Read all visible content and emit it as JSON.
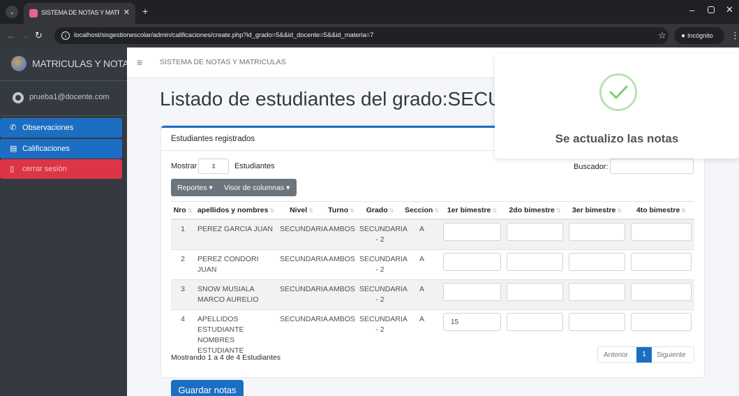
{
  "browser": {
    "tab_title": "SISTEMA DE NOTAS Y MATRICULAS",
    "url": "localhost/sisgestionescolar/admin/calificaciones/create.php?id_grado=5&&id_docente=5&&id_materia=7",
    "incognito_label": "Incógnito"
  },
  "sidebar": {
    "brand": "MATRICULAS Y NOTAS",
    "user": "prueba1@docente.com",
    "items": [
      {
        "label": "Observaciones",
        "icon": "megaphone-icon"
      },
      {
        "label": "Calificaciones",
        "icon": "list-icon"
      },
      {
        "label": "cerrar sesión",
        "icon": "door-icon"
      }
    ]
  },
  "navbar": {
    "title": "SISTEMA DE NOTAS Y MATRICULAS"
  },
  "page": {
    "heading": "Listado de estudiantes del grado:SECUNDA"
  },
  "card": {
    "title": "Estudiantes registrados",
    "show_label": "Mostrar",
    "show_suffix": "Estudiantes",
    "search_label": "Buscador:",
    "buttons": {
      "reports": "Reportes ▾",
      "columns": "Visor de columnas ▾"
    },
    "columns": [
      "Nro",
      "apellidos y nombres",
      "Nivel",
      "Turno",
      "Grado",
      "Seccion",
      "1er bimestre",
      "2do bimestre",
      "3er bimestre",
      "4to bimestre"
    ],
    "rows": [
      {
        "nro": "1",
        "name": "PEREZ GARCIA JUAN",
        "nivel": "SECUNDARIA",
        "turno": "AMBOS",
        "grado": "SECUNDARIA - 2",
        "seccion": "A",
        "b1": "",
        "b2": "",
        "b3": "",
        "b4": ""
      },
      {
        "nro": "2",
        "name": "PEREZ CONDORI JUAN",
        "nivel": "SECUNDARIA",
        "turno": "AMBOS",
        "grado": "SECUNDARIA - 2",
        "seccion": "A",
        "b1": "",
        "b2": "",
        "b3": "",
        "b4": ""
      },
      {
        "nro": "3",
        "name": "SNOW MUSIALA MARCO AURELIO",
        "nivel": "SECUNDARIA",
        "turno": "AMBOS",
        "grado": "SECUNDARIA - 2",
        "seccion": "A",
        "b1": "",
        "b2": "",
        "b3": "",
        "b4": ""
      },
      {
        "nro": "4",
        "name": "APELLIDOS ESTUDIANTE NOMBRES ESTUDIANTE",
        "nivel": "SECUNDARIA",
        "turno": "AMBOS",
        "grado": "SECUNDARIA - 2",
        "seccion": "A",
        "b1": "15",
        "b2": "",
        "b3": "",
        "b4": ""
      }
    ],
    "info": "Mostrando 1 a 4 de 4 Estudiantes",
    "pager": {
      "prev": "Anterior",
      "page": "1",
      "next": "Siguiente"
    }
  },
  "save_button": "Guardar notas",
  "toast": {
    "message": "Se actualizo las notas"
  }
}
